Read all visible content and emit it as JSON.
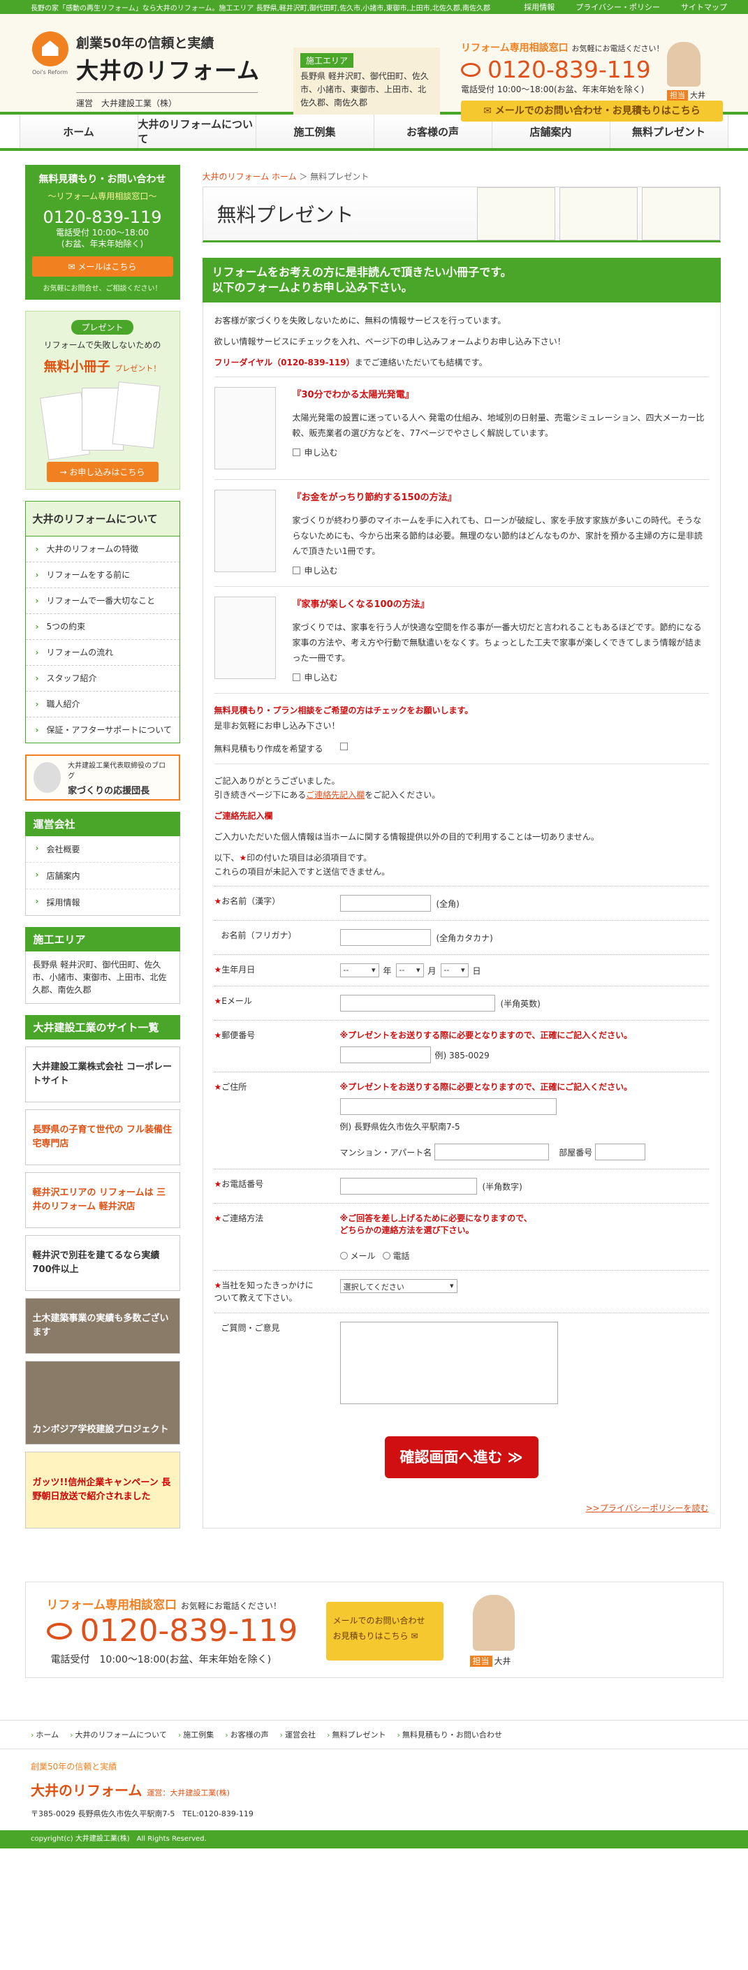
{
  "topbar": {
    "text": "長野の家「感動の再生リフォーム」なら大井のリフォーム。施工エリア 長野県,軽井沢町,御代田町,佐久市,小諸市,東御市,上田市,北佐久郡,南佐久郡",
    "links": [
      "採用情報",
      "プライバシー・ポリシー",
      "サイトマップ"
    ]
  },
  "header": {
    "catch": "創業50年の信頼と実績",
    "logo": "大井のリフォーム",
    "logo_sub": "Ooi's Reform",
    "operator": "運営　大井建設工業（株）",
    "area_tag": "施工エリア",
    "area_text": "長野県 軽井沢町、御代田町、佐久市、小諸市、東御市、上田市、北佐久郡、南佐久郡",
    "contact_label": "リフォーム専用相談窓口",
    "contact_sub": "お気軽にお電話ください！",
    "tel": "0120-839-119",
    "hours": "電話受付 10:00～18:00(お盆、年末年始を除く)",
    "mail_btn": "メールでのお問い合わせ・お見積もりはこちら",
    "staff_tag": "担当",
    "staff_name": "大井"
  },
  "nav": [
    "ホーム",
    "大井のリフォームについて",
    "施工例集",
    "お客様の声",
    "店舗案内",
    "無料プレゼント"
  ],
  "side": {
    "free": {
      "title": "無料見積もり・お問い合わせ",
      "sub": "～リフォーム専用相談窓口～",
      "tel": "0120-839-119",
      "hours1": "電話受付 10:00～18:00",
      "hours2": "(お盆、年末年始除く)",
      "btn": "メールはこちら",
      "note": "お気軽にお問合せ、ご相談ください！"
    },
    "present": {
      "badge": "プレゼント",
      "t1": "リフォームで失敗しないための",
      "t2": "無料小冊子",
      "t2s": "プレゼント！",
      "btn": "→ お申し込みはこちら"
    },
    "about": {
      "title": "大井のリフォームについて",
      "items": [
        "大井のリフォームの特徴",
        "リフォームをする前に",
        "リフォームで一番大切なこと",
        "5つの約束",
        "リフォームの流れ",
        "スタッフ紹介",
        "職人紹介",
        "保証・アフターサポートについて"
      ]
    },
    "blog": {
      "t1": "大井建設工業代表取締役のブログ",
      "t2": "家づくりの応援団長"
    },
    "company": {
      "title": "運営会社",
      "items": [
        "会社概要",
        "店舗案内",
        "採用情報"
      ]
    },
    "area": {
      "title": "施工エリア",
      "text": "長野県 軽井沢町、御代田町、佐久市、小諸市、東御市、上田市、北佐久郡、南佐久郡"
    },
    "sites": {
      "title": "大井建設工業のサイト一覧",
      "banners": [
        "大井建設工業株式会社 コーポレートサイト",
        "長野県の子育て世代の フル装備住宅専門店",
        "軽井沢エリアの リフォームは 三井のリフォーム 軽井沢店",
        "軽井沢で別荘を建てるなら実績700件以上",
        "土木建築事業の実績も多数ございます",
        "カンボジア学校建設プロジェクト",
        "ガッツ!!信州企業キャンペーン 長野朝日放送で紹介されました"
      ]
    }
  },
  "main": {
    "crumb_home": "大井のリフォーム ホーム",
    "crumb_current": "無料プレゼント",
    "title": "無料プレゼント",
    "lead1": "リフォームをお考えの方に是非読んで頂きたい小冊子です。",
    "lead2": "以下のフォームよりお申し込み下さい。",
    "intro1": "お客様が家づくりを失敗しないために、無料の情報サービスを行っています。",
    "intro2": "欲しい情報サービスにチェックを入れ、ページ下の申し込みフォームよりお申し込み下さい！",
    "intro3_red": "フリーダイヤル（0120-839-119）",
    "intro3": "までご連絡いただいても結構です。",
    "items": [
      {
        "title": "『30分でわかる太陽光発電』",
        "desc": "太陽光発電の設置に迷っている人へ 発電の仕組み、地域別の日射量、売電シミュレーション、四大メーカー比較、販売業者の選び方などを、77ページでやさしく解説しています。",
        "check": "申し込む"
      },
      {
        "title": "『お金をがっちり節約する150の方法』",
        "desc": "家づくりが終わり夢のマイホームを手に入れても、ローンが破綻し、家を手放す家族が多いこの時代。そうならないためにも、今から出来る節約は必要。無理のない節約はどんなものか、家計を預かる主婦の方に是非読んで頂きたい1冊です。",
        "check": "申し込む"
      },
      {
        "title": "『家事が楽しくなる100の方法』",
        "desc": "家づくりでは、家事を行う人が快適な空間を作る事が一番大切だと言われることもあるほどです。節約になる家事の方法や、考え方や行動で無駄遣いをなくす。ちょっとした工夫で家事が楽しくできてしまう情報が詰まった一冊です。",
        "check": "申し込む"
      }
    ],
    "est_red": "無料見積もり・プラン相談をご希望の方はチェックをお願いします。",
    "est_sub": "是非お気軽にお申し込み下さい！",
    "est_label": "無料見積もり作成を希望する",
    "thanks1": "ご記入ありがとうございました。",
    "thanks2a": "引き続きページ下にある",
    "thanks2link": "ご連絡先記入欄",
    "thanks2b": "をご記入ください。",
    "contact_head": "ご連絡先記入欄",
    "privacy_note": "ご入力いただいた個人情報は当ホームに関する情報提供以外の目的で利用することは一切ありません。",
    "req1": "以下、",
    "req1b": "印の付いた項目は必須項目です。",
    "req2": "これらの項目が未記入ですと送信できません。",
    "form": {
      "name": "お名前（漢字）",
      "name_hint": "(全角)",
      "kana": "お名前（フリガナ）",
      "kana_hint": "(全角カタカナ)",
      "birth": "生年月日",
      "birth_y": "--",
      "y": "年",
      "birth_m": "--",
      "m": "月",
      "birth_d": "--",
      "d": "日",
      "email": "Eメール",
      "email_hint": "(半角英数)",
      "zip": "郵便番号",
      "zip_note": "※プレゼントをお送りする際に必要となりますので、正確にご記入ください。",
      "zip_ex": "例) 385-0029",
      "addr": "ご住所",
      "addr_note": "※プレゼントをお送りする際に必要となりますので、正確にご記入ください。",
      "addr_ex": "例) 長野県佐久市佐久平駅南7-5",
      "apt": "マンション・アパート名",
      "room": "部屋番号",
      "tel": "お電話番号",
      "tel_hint": "(半角数字)",
      "method": "ご連絡方法",
      "method_note1": "※ご回答を差し上げるために必要になりますので、",
      "method_note2": "どちらかの連絡方法を選び下さい。",
      "m_mail": "メール",
      "m_tel": "電話",
      "source": "当社を知ったきっかけについて教えて下さい。",
      "source_sel": "選択してください",
      "q": "ご質問・ご意見"
    },
    "submit": "確認画面へ進む ≫",
    "privacy_link": ">>プライバシーポリシーを読む"
  },
  "bottom": {
    "label": "リフォーム専用相談窓口",
    "sub": "お気軽にお電話ください！",
    "tel": "0120-839-119",
    "hours": "電話受付　10:00～18:00(お盆、年末年始を除く)",
    "mail1": "メールでのお問い合わせ",
    "mail2": "お見積もりはこちら",
    "staff_tag": "担当",
    "staff_name": "大井"
  },
  "footer": {
    "links": [
      "ホーム",
      "大井のリフォームについて",
      "施工例集",
      "お客様の声",
      "運営会社",
      "無料プレゼント",
      "無料見積もり・お問い合わせ"
    ],
    "t1": "創業50年の信頼と実績",
    "t2": "大井のリフォーム",
    "t2s": "運営：大井建設工業(株)",
    "t3": "〒385-0029 長野県佐久市佐久平駅南7-5　TEL:0120-839-119",
    "copy": "copyright(c) 大井建設工業(株)　All Rights Reserved."
  }
}
